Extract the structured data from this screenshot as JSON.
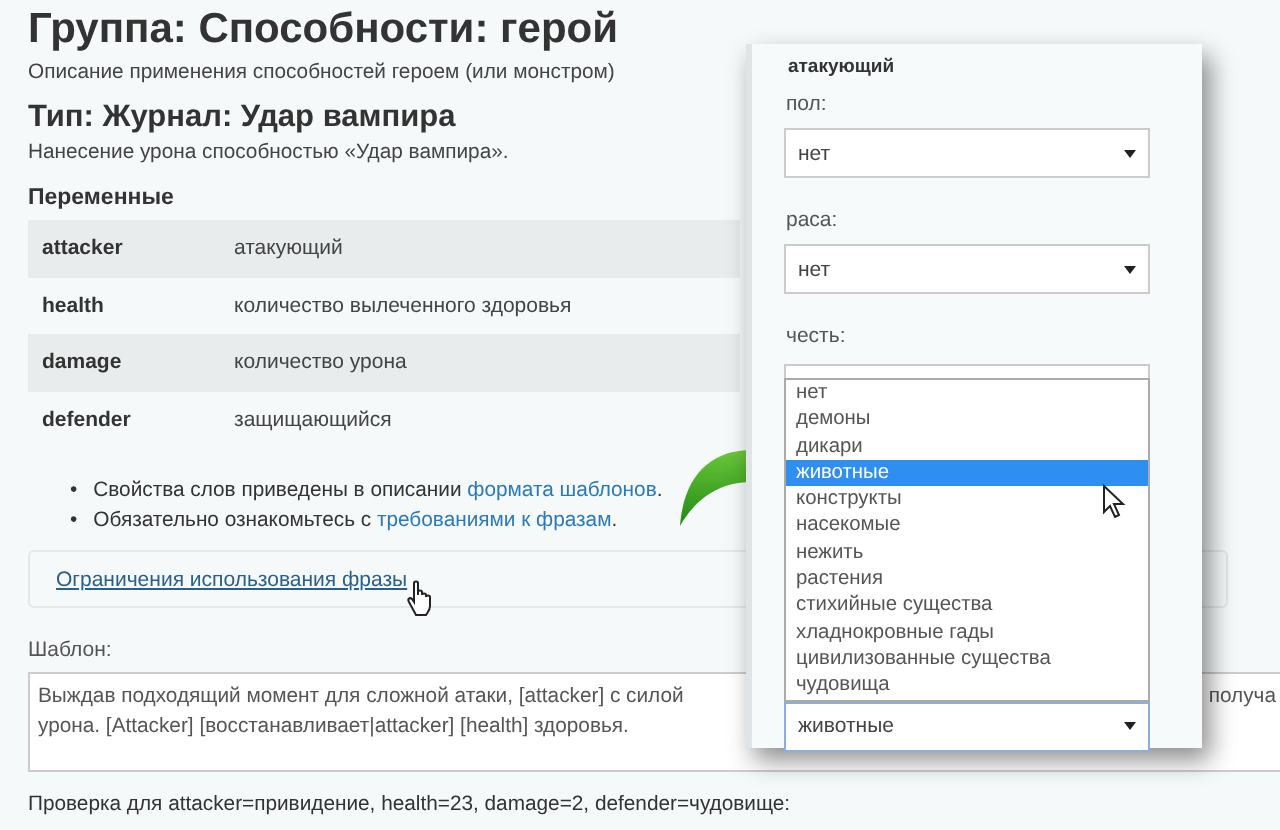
{
  "title": "Группа: Способности: герой",
  "description": "Описание применения способностей героем (или монстром)",
  "type_title": "Тип: Журнал: Удар вампира",
  "type_description": "Нанесение урона способностью «Удар вампира».",
  "variables": {
    "heading": "Переменные",
    "rows": [
      {
        "name": "attacker",
        "description": "атакующий"
      },
      {
        "name": "health",
        "description": "количество вылеченного здоровья"
      },
      {
        "name": "damage",
        "description": "количество урона"
      },
      {
        "name": "defender",
        "description": "защищающийся"
      }
    ]
  },
  "notes": [
    {
      "marker": "•",
      "text": "Свойства слов приведены в описании ",
      "link": "формата шаблонов",
      "after": "."
    },
    {
      "marker": "•",
      "text": "Обязательно ознакомьтесь с ",
      "link": "требованиями к фразам",
      "after": "."
    }
  ],
  "restrictions_link": "Ограничения использования фразы",
  "template": {
    "label": "Шаблон:",
    "line_1": "Выждав подходящий момент для сложной атаки, [attacker] с силой",
    "line_1_end": "получа",
    "line_2": "урона. [Attacker] [восстанавливает|attacker] [health] здоровья."
  },
  "check_line": "Проверка для attacker=привидение, health=23, damage=2, defender=чудовище:",
  "popup": {
    "heading": "атакующий",
    "fields": [
      {
        "kind": "select",
        "label": "пол:",
        "value": "нет"
      },
      {
        "kind": "select",
        "label": "раса:",
        "value": "нет"
      },
      {
        "kind": "covered",
        "label": "честь:"
      },
      {
        "kind": "open-select",
        "value": "животные",
        "options": [
          {
            "label": "нет",
            "selected": false
          },
          {
            "label": "демоны",
            "selected": false
          },
          {
            "label": "дикари",
            "selected": false
          },
          {
            "label": "животные",
            "selected": true
          },
          {
            "label": "конструкты",
            "selected": false
          },
          {
            "label": "насекомые",
            "selected": false
          },
          {
            "label": "нежить",
            "selected": false
          },
          {
            "label": "растения",
            "selected": false
          },
          {
            "label": "стихийные существа",
            "selected": false
          },
          {
            "label": "хладнокровные гады",
            "selected": false
          },
          {
            "label": "цивилизованные существа",
            "selected": false
          },
          {
            "label": "чудовища",
            "selected": false
          }
        ]
      }
    ]
  }
}
